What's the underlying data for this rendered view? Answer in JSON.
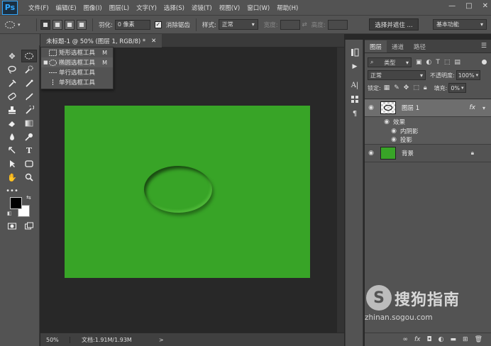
{
  "app": {
    "logo": "Ps"
  },
  "menu": [
    "文件(F)",
    "编辑(E)",
    "图像(I)",
    "图层(L)",
    "文字(Y)",
    "选择(S)",
    "滤镜(T)",
    "视图(V)",
    "窗口(W)",
    "帮助(H)"
  ],
  "window_controls": {
    "minimize": "—",
    "restore": "□",
    "close": "✕"
  },
  "options": {
    "feather_label": "羽化:",
    "feather_value": "0 像素",
    "antialias_checked": true,
    "antialias_label": "消除锯齿",
    "style_label": "样式:",
    "style_value": "正常",
    "width_label": "宽度:",
    "height_label": "高度:",
    "select_mask_label": "选择并遮住 ...",
    "workspace_value": "基本功能"
  },
  "flyout": {
    "items": [
      {
        "label": "矩形选框工具",
        "key": "M"
      },
      {
        "label": "椭圆选框工具",
        "key": "M",
        "current": true
      },
      {
        "label": "单行选框工具",
        "key": ""
      },
      {
        "label": "单列选框工具",
        "key": ""
      }
    ]
  },
  "document": {
    "tab_title": "未标题-1 @ 50% (图层 1, RGB/8) *",
    "tab_close": "✕",
    "canvas_color": "#38a427"
  },
  "status": {
    "zoom": "50%",
    "doc_info": "文档:1.91M/1.93M",
    "arrow": ">"
  },
  "layers_panel": {
    "tabs": [
      "图层",
      "通道",
      "路径"
    ],
    "filter_value": "类型",
    "blend_mode": "正常",
    "opacity_label": "不透明度:",
    "opacity_value": "100%",
    "lock_label": "锁定:",
    "fill_label": "填充:",
    "fill_value": "0%",
    "layers": [
      {
        "name": "图层 1",
        "fx": "fx",
        "selected": true
      },
      {
        "name": "背景",
        "locked": true
      }
    ],
    "effects_label": "效果",
    "effects": [
      "内阴影",
      "投影"
    ]
  },
  "watermark": {
    "text": "搜狗指南",
    "url": "zhinan.sogou.com"
  }
}
